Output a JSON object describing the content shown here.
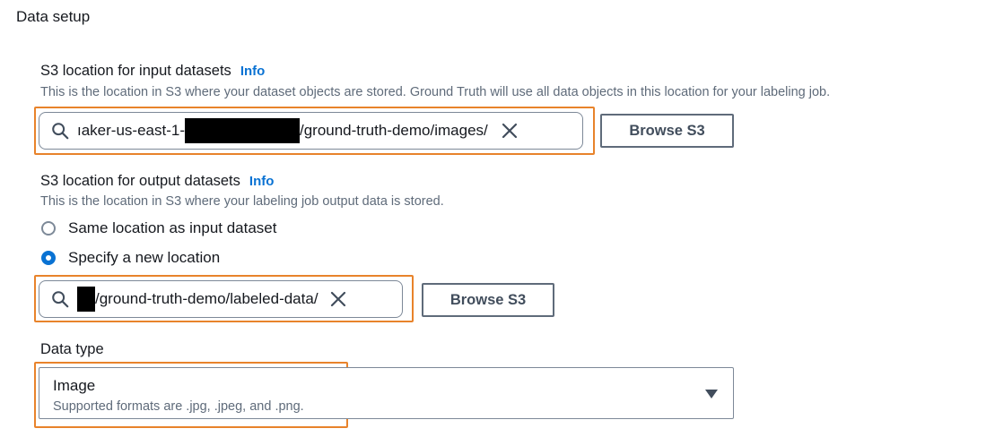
{
  "section": {
    "title": "Data setup"
  },
  "input_location": {
    "label": "S3 location for input datasets",
    "info": "Info",
    "description": "This is the location in S3 where your dataset objects are stored. Ground Truth will use all data objects in this location for your labeling job.",
    "value_prefix": "ıaker-us-east-1-",
    "value_suffix": "/ground-truth-demo/images/",
    "browse_label": "Browse S3"
  },
  "output_location": {
    "label": "S3 location for output datasets",
    "info": "Info",
    "description": "This is the location in S3 where your labeling job output data is stored.",
    "options": [
      {
        "label": "Same location as input dataset",
        "checked": false
      },
      {
        "label": "Specify a new location",
        "checked": true
      }
    ],
    "value_suffix": "/ground-truth-demo/labeled-data/",
    "browse_label": "Browse S3"
  },
  "data_type": {
    "label": "Data type",
    "selected": "Image",
    "selected_description": "Supported formats are .jpg, .jpeg, and .png."
  },
  "colors": {
    "highlight": "#e8832b",
    "link": "#0972d3",
    "text": "#16191f",
    "secondary_text": "#5f6b7a"
  },
  "icons": {
    "search": "search-icon",
    "clear": "close-icon",
    "dropdown": "caret-down-icon"
  }
}
